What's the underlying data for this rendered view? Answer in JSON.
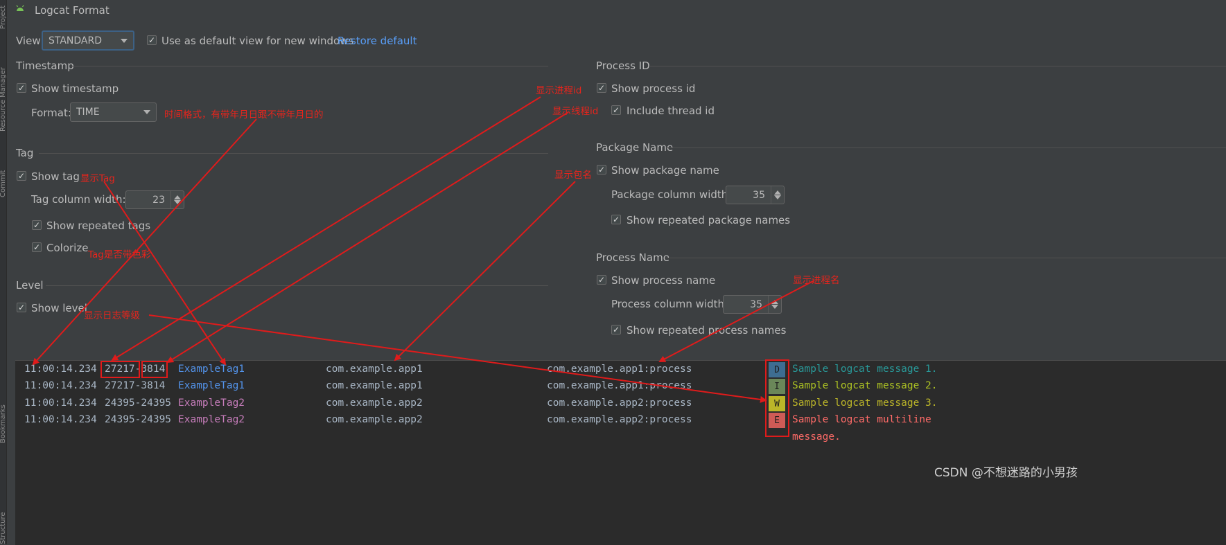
{
  "window": {
    "title": "Logcat Format"
  },
  "sidebar": {
    "items": [
      "Project",
      "Resource Manager",
      "Commit",
      "Bookmarks",
      "Structure"
    ]
  },
  "view": {
    "label": "View",
    "selected": "STANDARD",
    "default_checkbox_label": "Use as default view for new windows",
    "restore_link": "Restore default"
  },
  "timestamp": {
    "section": "Timestamp",
    "show_label": "Show timestamp",
    "format_label": "Format:",
    "format_value": "TIME"
  },
  "tag": {
    "section": "Tag",
    "show_label": "Show tag",
    "width_label": "Tag column width:",
    "width_value": "23",
    "repeated_label": "Show repeated tags",
    "colorize_label": "Colorize"
  },
  "level": {
    "section": "Level",
    "show_label": "Show level"
  },
  "process_id": {
    "section": "Process ID",
    "show_label": "Show process id",
    "thread_label": "Include thread id"
  },
  "package": {
    "section": "Package Name",
    "show_label": "Show package name",
    "width_label": "Package column width:",
    "width_value": "35",
    "repeated_label": "Show repeated package names"
  },
  "process_name": {
    "section": "Process Name",
    "show_label": "Show process name",
    "width_label": "Process column width:",
    "width_value": "35",
    "repeated_label": "Show repeated process names"
  },
  "preview": {
    "rows": [
      {
        "time": "11:00:14.234",
        "pid": "27217-3814",
        "tag": "ExampleTag1",
        "package": "com.example.app1",
        "process": "com.example.app1:process",
        "level": "D",
        "message": "Sample logcat message 1."
      },
      {
        "time": "11:00:14.234",
        "pid": "27217-3814",
        "tag": "ExampleTag1",
        "package": "com.example.app1",
        "process": "com.example.app1:process",
        "level": "I",
        "message": "Sample logcat message 2."
      },
      {
        "time": "11:00:14.234",
        "pid": "24395-24395",
        "tag": "ExampleTag2",
        "package": "com.example.app2",
        "process": "com.example.app2:process",
        "level": "W",
        "message": "Sample logcat message 3."
      },
      {
        "time": "11:00:14.234",
        "pid": "24395-24395",
        "tag": "ExampleTag2",
        "package": "com.example.app2",
        "process": "com.example.app2:process",
        "level": "E",
        "message": "Sample logcat multiline"
      }
    ],
    "continuation": "message."
  },
  "annotations": {
    "timestamp_format": "时间格式，有带年月日跟不带年月日的",
    "show_tag": "显示Tag",
    "colorize": "Tag是否带色彩",
    "show_level": "显示日志等级",
    "process_id": "显示进程id",
    "thread_id": "显示线程id",
    "package": "显示包名",
    "process_name": "显示进程名"
  },
  "watermark": "CSDN @不想迷路的小男孩",
  "colors": {
    "background": "#3c3f41",
    "preview_bg": "#2b2b2b",
    "link": "#589df6",
    "annotation": "#e8241c",
    "tag1": "#5394ec",
    "tag2": "#c77dbb",
    "level_D": "#3e6d91",
    "level_I": "#6a8759",
    "level_W": "#bbb529",
    "level_E": "#cf5b56",
    "msg_D": "#299999",
    "msg_I": "#abc023",
    "msg_W": "#bbb529",
    "msg_E": "#ff6b68"
  }
}
